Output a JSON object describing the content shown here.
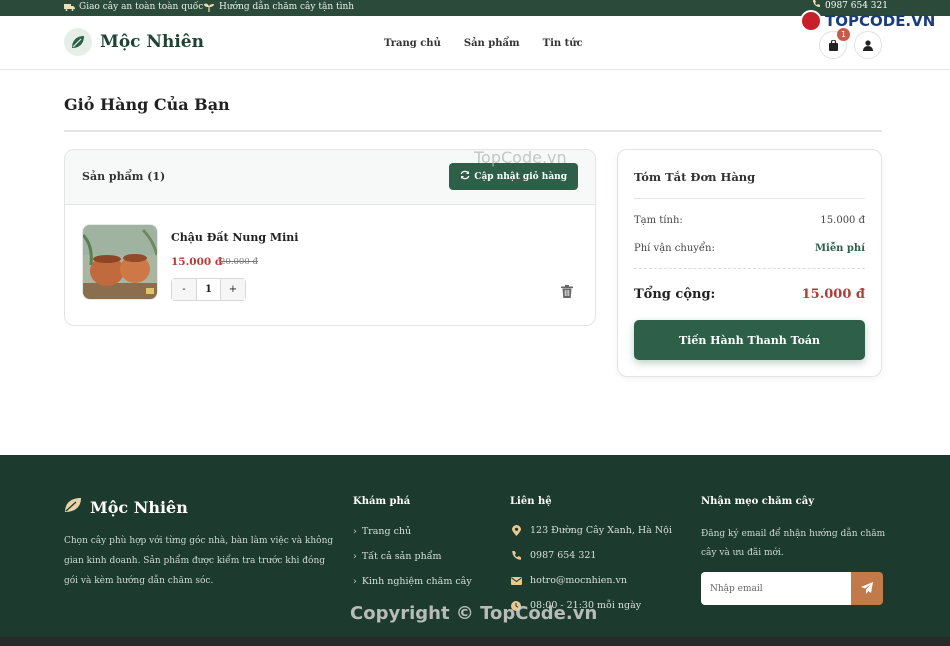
{
  "topbar": {
    "shipping": "Giao cây an toàn toàn quốc",
    "care": "Hướng dẫn chăm cây tận tình",
    "phone": "0987 654 321"
  },
  "watermark": {
    "logo_text": "TOPCODE.VN",
    "center": "TopCode.vn",
    "bottom": "Copyright © TopCode.vn"
  },
  "header": {
    "brand": "Mộc Nhiên",
    "nav": [
      "Trang chủ",
      "Sản phẩm",
      "Tin tức"
    ],
    "cart_count": "1"
  },
  "page": {
    "title": "Giỏ Hàng Của Bạn"
  },
  "cart": {
    "header_label": "Sản phẩm (1)",
    "update_label": "Cập nhật giỏ hàng",
    "items": [
      {
        "name": "Chậu Đất Nung Mini",
        "price": "15.000 đ",
        "old_price": "20.000 đ",
        "quantity": "1"
      }
    ],
    "minus": "-",
    "plus": "+"
  },
  "summary": {
    "title": "Tóm Tắt Đơn Hàng",
    "subtotal_label": "Tạm tính:",
    "subtotal_value": "15.000 đ",
    "shipping_label": "Phí vận chuyển:",
    "shipping_value": "Miễn phí",
    "total_label": "Tổng cộng:",
    "total_value": "15.000 đ",
    "checkout_label": "Tiến Hành Thanh Toán"
  },
  "footer": {
    "brand": "Mộc Nhiên",
    "description": "Chọn cây phù hợp với từng góc nhà, bàn làm việc và không gian kinh doanh. Sản phẩm được kiểm tra trước khi đóng gói và kèm hướng dẫn chăm sóc.",
    "explore_title": "Khám phá",
    "explore_links": [
      "Trang chủ",
      "Tất cả sản phẩm",
      "Kinh nghiệm chăm cây"
    ],
    "contact_title": "Liên hệ",
    "address": "123 Đường Cây Xanh, Hà Nội",
    "phone": "0987 654 321",
    "email": "hotro@mocnhien.vn",
    "hours": "08:00 - 21:30 mỗi ngày",
    "newsletter_title": "Nhận mẹo chăm cây",
    "newsletter_text": "Đăng ký email để nhận hướng dẫn chăm cây và ưu đãi mới.",
    "email_placeholder": "Nhập email"
  },
  "colors": {
    "primary_green": "#2d5f49",
    "dark_green": "#1c3a2d",
    "price_red": "#b23b36",
    "accent_orange": "#c27a4a"
  }
}
